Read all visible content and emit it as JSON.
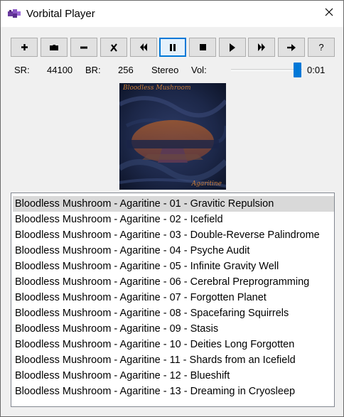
{
  "window": {
    "title": "Vorbital Player",
    "icon": "puzzle-app-icon",
    "close_icon": "close-icon"
  },
  "toolbar": {
    "buttons": [
      {
        "name": "add-button",
        "label": "+",
        "icon": "plus-icon"
      },
      {
        "name": "open-folder-button",
        "label": "",
        "icon": "folder-icon"
      },
      {
        "name": "remove-button",
        "label": "−",
        "icon": "minus-icon"
      },
      {
        "name": "clear-button",
        "label": "✗",
        "icon": "x-icon"
      },
      {
        "name": "previous-button",
        "label": "",
        "icon": "skip-back-icon"
      },
      {
        "name": "pause-button",
        "label": "",
        "icon": "pause-icon",
        "active": true
      },
      {
        "name": "stop-button",
        "label": "",
        "icon": "stop-icon"
      },
      {
        "name": "play-button",
        "label": "",
        "icon": "play-icon"
      },
      {
        "name": "next-button",
        "label": "",
        "icon": "skip-forward-icon"
      },
      {
        "name": "random-button",
        "label": "",
        "icon": "arrow-right-icon"
      },
      {
        "name": "about-button",
        "label": "?",
        "icon": "question-icon"
      }
    ]
  },
  "status": {
    "sr_label": "SR:",
    "sr_value": "44100",
    "br_label": "BR:",
    "br_value": "256",
    "channels": "Stereo",
    "vol_label": "Vol:",
    "volume": 0.92,
    "time": "0:01"
  },
  "album": {
    "title": "Bloodless Mushroom",
    "subtitle": "Agaritine"
  },
  "playlist": {
    "selected_index": 0,
    "tracks": [
      "Bloodless Mushroom - Agaritine - 01 - Gravitic Repulsion",
      "Bloodless Mushroom - Agaritine - 02 - Icefield",
      "Bloodless Mushroom - Agaritine - 03 - Double-Reverse Palindrome",
      "Bloodless Mushroom - Agaritine - 04 - Psyche Audit",
      "Bloodless Mushroom - Agaritine - 05 - Infinite Gravity Well",
      "Bloodless Mushroom - Agaritine - 06 - Cerebral Preprogramming",
      "Bloodless Mushroom - Agaritine - 07 - Forgotten Planet",
      "Bloodless Mushroom - Agaritine - 08 - Spacefaring Squirrels",
      "Bloodless Mushroom - Agaritine - 09 - Stasis",
      "Bloodless Mushroom - Agaritine - 10 - Deities Long Forgotten",
      "Bloodless Mushroom - Agaritine - 11 - Shards from an Icefield",
      "Bloodless Mushroom - Agaritine - 12 - Blueshift",
      "Bloodless Mushroom - Agaritine - 13 - Dreaming in Cryosleep"
    ]
  }
}
